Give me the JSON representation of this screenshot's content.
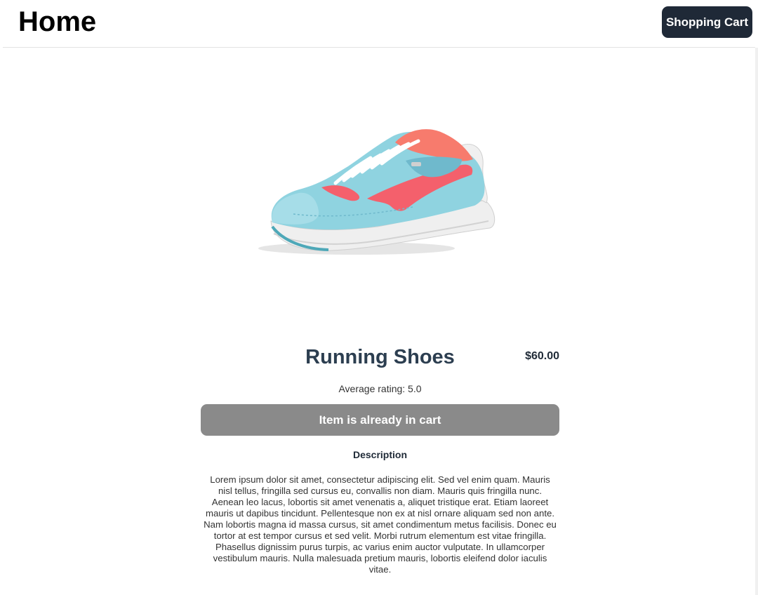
{
  "header": {
    "title": "Home",
    "cart_button_label": "Shopping Cart"
  },
  "product": {
    "name": "Running Shoes",
    "price": "$60.00",
    "rating_text": "Average rating: 5.0",
    "cart_status_label": "Item is already in cart",
    "description_heading": "Description",
    "description": "Lorem ipsum dolor sit amet, consectetur adipiscing elit. Sed vel enim quam. Mauris nisl tellus, fringilla sed cursus eu, convallis non diam. Mauris quis fringilla nunc. Aenean leo lacus, lobortis sit amet venenatis a, aliquet tristique erat. Etiam laoreet mauris ut dapibus tincidunt. Pellentesque non ex at nisl ornare aliquam sed non ante. Nam lobortis magna id massa cursus, sit amet condimentum metus facilisis. Donec eu tortor at est tempor cursus et sed velit. Morbi rutrum elementum est vitae fringilla. Phasellus dignissim purus turpis, ac varius enim auctor vulputate. In ullamcorper vestibulum mauris. Nulla malesuada pretium mauris, lobortis eleifend dolor iaculis vitae.",
    "image_icon": "running-shoe-image"
  },
  "colors": {
    "cart_button_bg": "#1f2937",
    "disabled_button_bg": "#8a8a8a",
    "shoe_upper": "#8fd3e0",
    "shoe_accent": "#f4606c",
    "title_text": "#2c3e50"
  }
}
